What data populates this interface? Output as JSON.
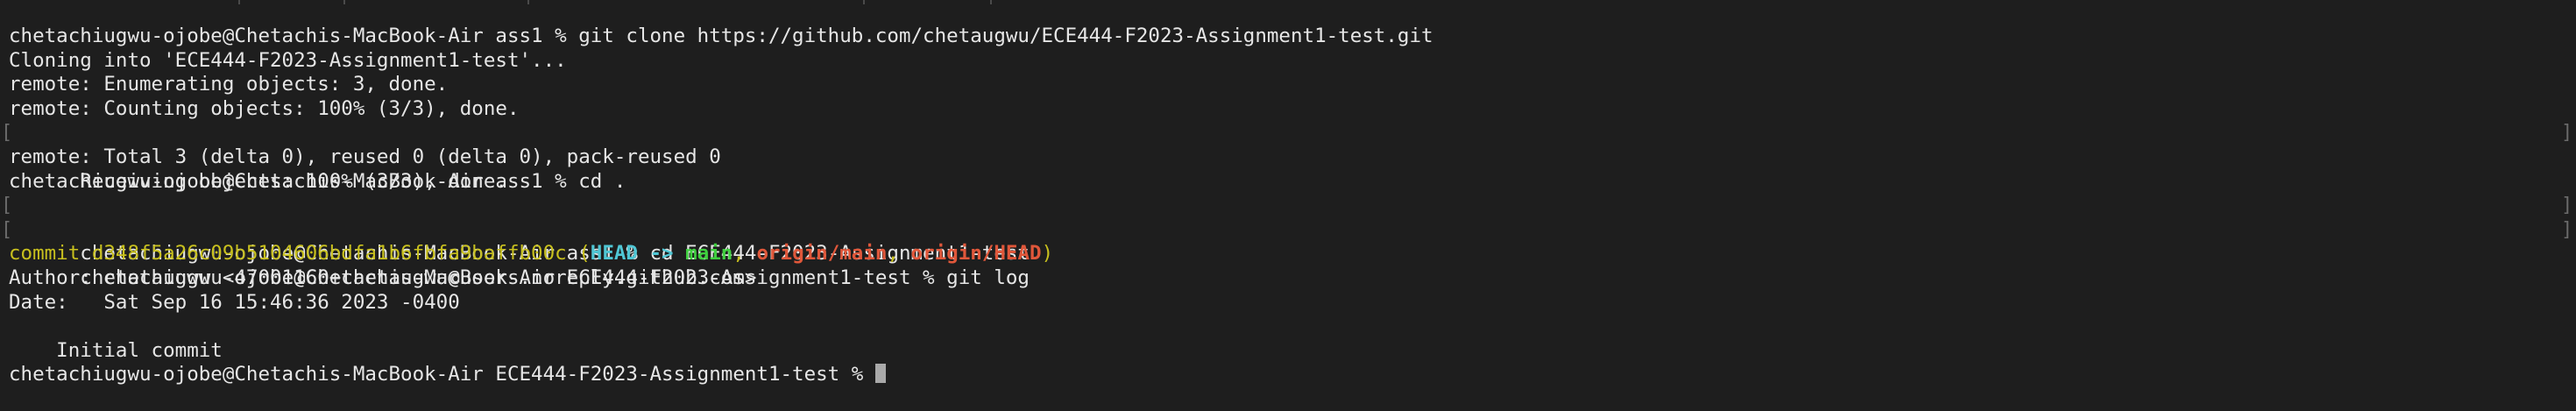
{
  "terminal": {
    "lines": [
      "chetachiugwu-ojobe@Chetachis-MacBook-Air ass1 % git clone https://github.com/chetaugwu/ECE444-F2023-Assignment1-test.git",
      "Cloning into 'ECE444-F2023-Assignment1-test'...",
      "remote: Enumerating objects: 3, done.",
      "remote: Counting objects: 100% (3/3), done.",
      "Receiving objects: 100% (3/3), done.",
      "remote: Total 3 (delta 0), reused 0 (delta 0), pack-reused 0",
      "chetachiugwu-ojobe@Chetachis-MacBook-Air ass1 % cd .",
      "chetachiugwu-ojobe@Chetachis-MacBook-Air ass1 % cd ECE444-F2023-Assignment1-test",
      "chetachiugwu-ojobe@Chetachis-MacBook-Air ECE444-F2023-Assignment1-test % git log"
    ],
    "commit": {
      "prefix": "commit ",
      "hash": "d348f5a26c09b5104606bdfa1b6fbfa9baffb00c",
      "open_paren": " (",
      "head": "HEAD -> ",
      "branch": "main",
      "sep1": ", ",
      "origin_main": "origin/main",
      "sep2": ", ",
      "origin_head": "origin/HEAD",
      "close_paren": ")"
    },
    "author_line": "Author: chetaugwu <47001160+chetaugwu@users.noreply.github.com>",
    "date_line": "Date:   Sat Sep 16 15:46:36 2023 -0400",
    "blank_line": "",
    "message_line": "    Initial commit",
    "prompt_line": "chetachiugwu-ojobe@Chetachis-MacBook-Air ECE444-F2023-Assignment1-test % ",
    "marker_char": "[",
    "marker_char_right": "]",
    "colors": {
      "background": "#1e1e1e",
      "text": "#e6e6e6",
      "hash": "#c8c01e",
      "head": "#4fc6d4",
      "branch": "#3fcf3f",
      "origin": "#e0573a",
      "cursor": "#a9a9a9"
    }
  }
}
